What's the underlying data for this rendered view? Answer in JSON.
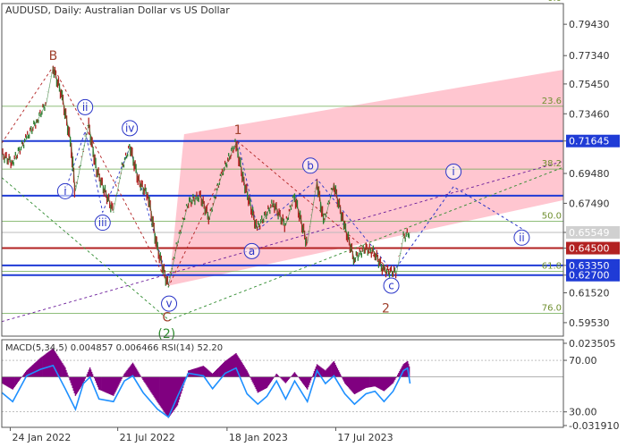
{
  "chart_data": [
    {
      "type": "line",
      "title": "AUDUSD, Daily:  Australian Dollar vs US Dollar",
      "ylim": [
        0.5863,
        0.8081
      ],
      "y_ticks": [
        "0.79430",
        "0.77340",
        "0.75450",
        "0.73460",
        "0.71645",
        "0.69480",
        "0.67490",
        "0.65549",
        "0.64500",
        "0.63350",
        "0.62700",
        "0.61520",
        "0.59530"
      ],
      "x_ticks": [
        "24 Jan 2022",
        "21 Jul 2022",
        "18 Jan 2023",
        "17 Jul 2023"
      ],
      "x_range": [
        "2022-01-10",
        "2023-11-20"
      ],
      "price_path": [
        {
          "x": "2022-01-10",
          "y": 0.7078
        },
        {
          "x": "2022-01-28",
          "y": 0.702
        },
        {
          "x": "2022-02-20",
          "y": 0.718
        },
        {
          "x": "2022-03-10",
          "y": 0.73
        },
        {
          "x": "2022-03-25",
          "y": 0.742
        },
        {
          "x": "2022-04-05",
          "y": 0.7661
        },
        {
          "x": "2022-04-20",
          "y": 0.747
        },
        {
          "x": "2022-05-05",
          "y": 0.715
        },
        {
          "x": "2022-05-12",
          "y": 0.683
        },
        {
          "x": "2022-05-25",
          "y": 0.71
        },
        {
          "x": "2022-06-03",
          "y": 0.728
        },
        {
          "x": "2022-06-16",
          "y": 0.698
        },
        {
          "x": "2022-06-30",
          "y": 0.683
        },
        {
          "x": "2022-07-14",
          "y": 0.67
        },
        {
          "x": "2022-07-28",
          "y": 0.698
        },
        {
          "x": "2022-08-11",
          "y": 0.713
        },
        {
          "x": "2022-08-25",
          "y": 0.69
        },
        {
          "x": "2022-09-10",
          "y": 0.68
        },
        {
          "x": "2022-09-25",
          "y": 0.645
        },
        {
          "x": "2022-10-13",
          "y": 0.62
        },
        {
          "x": "2022-10-26",
          "y": 0.645
        },
        {
          "x": "2022-11-15",
          "y": 0.675
        },
        {
          "x": "2022-12-05",
          "y": 0.68
        },
        {
          "x": "2022-12-20",
          "y": 0.665
        },
        {
          "x": "2023-01-10",
          "y": 0.695
        },
        {
          "x": "2023-02-02",
          "y": 0.715
        },
        {
          "x": "2023-02-15",
          "y": 0.69
        },
        {
          "x": "2023-03-09",
          "y": 0.658
        },
        {
          "x": "2023-04-05",
          "y": 0.675
        },
        {
          "x": "2023-04-25",
          "y": 0.66
        },
        {
          "x": "2023-05-10",
          "y": 0.68
        },
        {
          "x": "2023-05-31",
          "y": 0.648
        },
        {
          "x": "2023-06-16",
          "y": 0.69
        },
        {
          "x": "2023-06-28",
          "y": 0.662
        },
        {
          "x": "2023-07-14",
          "y": 0.688
        },
        {
          "x": "2023-08-01",
          "y": 0.66
        },
        {
          "x": "2023-08-17",
          "y": 0.638
        },
        {
          "x": "2023-09-05",
          "y": 0.645
        },
        {
          "x": "2023-09-20",
          "y": 0.642
        },
        {
          "x": "2023-10-05",
          "y": 0.63
        },
        {
          "x": "2023-10-26",
          "y": 0.629
        },
        {
          "x": "2023-11-06",
          "y": 0.652
        },
        {
          "x": "2023-11-17",
          "y": 0.6555
        }
      ],
      "fib_levels": [
        {
          "label": "0.0",
          "y": 0.8081
        },
        {
          "label": "23.6",
          "y": 0.7396
        },
        {
          "label": "38.2",
          "y": 0.6977
        },
        {
          "label": "50.0",
          "y": 0.663
        },
        {
          "label": "61.8",
          "y": 0.6296
        },
        {
          "label": "76.0",
          "y": 0.6015
        }
      ],
      "support_resistance": [
        {
          "value": "0.71645",
          "y": 0.71645,
          "color": "#1f3bd6"
        },
        {
          "value": "0.68000",
          "y": 0.68,
          "color": "#1f3bd6"
        },
        {
          "value": "0.64500",
          "y": 0.645,
          "color": "#b22222"
        },
        {
          "value": "0.63350",
          "y": 0.6335,
          "color": "#1f3bd6"
        },
        {
          "value": "0.62700",
          "y": 0.627,
          "color": "#1f3bd6"
        }
      ],
      "current_price": {
        "value": "0.65549",
        "y": 0.65549
      },
      "wave_labels": [
        {
          "text": "B",
          "x": "2022-04-05",
          "y": 0.7735,
          "color": "#a0412d",
          "circle": false
        },
        {
          "text": "ii",
          "x": "2022-05-28",
          "y": 0.739,
          "color": "#2a35c8",
          "circle": true
        },
        {
          "text": "iv",
          "x": "2022-08-10",
          "y": 0.725,
          "color": "#2a35c8",
          "circle": true
        },
        {
          "text": "i",
          "x": "2022-04-25",
          "y": 0.683,
          "color": "#2a35c8",
          "circle": true
        },
        {
          "text": "iii",
          "x": "2022-06-26",
          "y": 0.662,
          "color": "#2a35c8",
          "circle": true
        },
        {
          "text": "v",
          "x": "2022-10-14",
          "y": 0.608,
          "color": "#2a35c8",
          "circle": true
        },
        {
          "text": "C",
          "x": "2022-10-10",
          "y": 0.599,
          "color": "#a0412d",
          "circle": false
        },
        {
          "text": "(2)",
          "x": "2022-10-10",
          "y": 0.588,
          "color": "#2e8b2e",
          "circle": false
        },
        {
          "text": "1",
          "x": "2023-02-05",
          "y": 0.724,
          "color": "#a0412d",
          "circle": false
        },
        {
          "text": "b",
          "x": "2023-06-05",
          "y": 0.7,
          "color": "#2a35c8",
          "circle": true
        },
        {
          "text": "a",
          "x": "2023-02-28",
          "y": 0.643,
          "color": "#2a35c8",
          "circle": true
        },
        {
          "text": "c",
          "x": "2023-10-17",
          "y": 0.62,
          "color": "#2a35c8",
          "circle": true
        },
        {
          "text": "2",
          "x": "2023-10-08",
          "y": 0.605,
          "color": "#a0412d",
          "circle": false
        },
        {
          "text": "i",
          "x": "2024-01-28",
          "y": 0.696,
          "color": "#2a35c8",
          "circle": true
        },
        {
          "text": "ii",
          "x": "2024-05-20",
          "y": 0.652,
          "color": "#2a35c8",
          "circle": true
        }
      ],
      "projection": [
        {
          "x": "2023-10-20",
          "y": 0.629
        },
        {
          "x": "2024-01-28",
          "y": 0.686
        },
        {
          "x": "2024-05-20",
          "y": 0.658
        }
      ],
      "channel": {
        "upper": [
          {
            "x": "2022-11-08",
            "y": 0.721
          },
          {
            "x": "2024-07-28",
            "y": 0.764
          }
        ],
        "lower": [
          {
            "x": "2022-10-14",
            "y": 0.62
          },
          {
            "x": "2024-07-28",
            "y": 0.677
          }
        ]
      },
      "trend_lines": [
        {
          "kind": "dashed",
          "color": "#b22222",
          "points": [
            {
              "x": "2022-01-10",
              "y": 0.715
            },
            {
              "x": "2022-04-05",
              "y": 0.7661
            },
            {
              "x": "2022-10-14",
              "y": 0.62
            },
            {
              "x": "2023-02-05",
              "y": 0.716
            },
            {
              "x": "2023-10-20",
              "y": 0.629
            }
          ]
        },
        {
          "kind": "dashed",
          "color": "#2e8b2e",
          "points": [
            {
              "x": "2022-01-10",
              "y": 0.692
            },
            {
              "x": "2022-10-14",
              "y": 0.597
            }
          ]
        },
        {
          "kind": "dashed",
          "color": "#2e8b2e",
          "points": [
            {
              "x": "2022-10-14",
              "y": 0.597
            },
            {
              "x": "2024-07-28",
              "y": 0.699
            }
          ]
        },
        {
          "kind": "dashed",
          "color": "#6a1b9a",
          "points": [
            {
              "x": "2022-01-10",
              "y": 0.596
            },
            {
              "x": "2024-07-28",
              "y": 0.703
            }
          ]
        },
        {
          "kind": "dashed",
          "color": "#2a35c8",
          "points": [
            {
              "x": "2022-04-25",
              "y": 0.683
            },
            {
              "x": "2022-05-28",
              "y": 0.723
            },
            {
              "x": "2022-06-26",
              "y": 0.669
            },
            {
              "x": "2022-08-10",
              "y": 0.712
            },
            {
              "x": "2022-10-14",
              "y": 0.62
            }
          ]
        },
        {
          "kind": "dashed",
          "color": "#2a35c8",
          "points": [
            {
              "x": "2023-02-05",
              "y": 0.716
            },
            {
              "x": "2023-03-10",
              "y": 0.657
            },
            {
              "x": "2023-06-16",
              "y": 0.691
            },
            {
              "x": "2023-10-20",
              "y": 0.629
            }
          ]
        }
      ]
    },
    {
      "type": "area",
      "title": "MACD(5,34,5) 0.004857 0.006466 RSI(14) 52.20",
      "y_ticks": [
        "0.023505",
        "70.00",
        "30.00",
        "-0.031910"
      ],
      "x_ticks": [
        "24 Jan 2022",
        "21 Jul 2022",
        "18 Jan 2023",
        "17 Jul 2023"
      ],
      "macd_ylim": [
        -0.03191,
        0.023505
      ],
      "rsi_ylim": [
        18,
        86
      ],
      "rsi_levels": [
        70,
        30
      ],
      "macd": [
        {
          "x": "2022-01-10",
          "y": -0.004
        },
        {
          "x": "2022-01-28",
          "y": -0.008
        },
        {
          "x": "2022-02-20",
          "y": 0.004
        },
        {
          "x": "2022-03-15",
          "y": 0.012
        },
        {
          "x": "2022-04-05",
          "y": 0.018
        },
        {
          "x": "2022-04-25",
          "y": 0.006
        },
        {
          "x": "2022-05-12",
          "y": -0.012
        },
        {
          "x": "2022-05-25",
          "y": -0.004
        },
        {
          "x": "2022-06-05",
          "y": 0.006
        },
        {
          "x": "2022-06-20",
          "y": -0.008
        },
        {
          "x": "2022-07-14",
          "y": -0.012
        },
        {
          "x": "2022-08-01",
          "y": 0.002
        },
        {
          "x": "2022-08-15",
          "y": 0.009
        },
        {
          "x": "2022-09-01",
          "y": -0.002
        },
        {
          "x": "2022-09-25",
          "y": -0.016
        },
        {
          "x": "2022-10-13",
          "y": -0.026
        },
        {
          "x": "2022-10-28",
          "y": -0.018
        },
        {
          "x": "2022-11-15",
          "y": 0.004
        },
        {
          "x": "2022-12-10",
          "y": 0.007
        },
        {
          "x": "2022-12-25",
          "y": 0.002
        },
        {
          "x": "2023-01-15",
          "y": 0.01
        },
        {
          "x": "2023-02-02",
          "y": 0.015
        },
        {
          "x": "2023-02-20",
          "y": 0.004
        },
        {
          "x": "2023-03-10",
          "y": -0.01
        },
        {
          "x": "2023-03-25",
          "y": -0.007
        },
        {
          "x": "2023-04-10",
          "y": 0.002
        },
        {
          "x": "2023-04-25",
          "y": -0.004
        },
        {
          "x": "2023-05-10",
          "y": 0.003
        },
        {
          "x": "2023-05-31",
          "y": -0.008
        },
        {
          "x": "2023-06-16",
          "y": 0.008
        },
        {
          "x": "2023-06-30",
          "y": 0.004
        },
        {
          "x": "2023-07-14",
          "y": 0.01
        },
        {
          "x": "2023-08-01",
          "y": -0.004
        },
        {
          "x": "2023-08-17",
          "y": -0.011
        },
        {
          "x": "2023-09-05",
          "y": -0.007
        },
        {
          "x": "2023-09-20",
          "y": -0.006
        },
        {
          "x": "2023-10-05",
          "y": -0.009
        },
        {
          "x": "2023-10-20",
          "y": -0.004
        },
        {
          "x": "2023-11-06",
          "y": 0.008
        },
        {
          "x": "2023-11-13",
          "y": 0.01
        },
        {
          "x": "2023-11-17",
          "y": 0.005
        }
      ],
      "rsi": [
        {
          "x": "2022-01-10",
          "y": 45
        },
        {
          "x": "2022-01-28",
          "y": 38
        },
        {
          "x": "2022-02-20",
          "y": 58
        },
        {
          "x": "2022-03-15",
          "y": 63
        },
        {
          "x": "2022-04-05",
          "y": 66
        },
        {
          "x": "2022-04-25",
          "y": 48
        },
        {
          "x": "2022-05-12",
          "y": 32
        },
        {
          "x": "2022-05-25",
          "y": 52
        },
        {
          "x": "2022-06-05",
          "y": 57
        },
        {
          "x": "2022-06-20",
          "y": 40
        },
        {
          "x": "2022-07-14",
          "y": 38
        },
        {
          "x": "2022-08-01",
          "y": 54
        },
        {
          "x": "2022-08-15",
          "y": 58
        },
        {
          "x": "2022-09-01",
          "y": 45
        },
        {
          "x": "2022-09-25",
          "y": 32
        },
        {
          "x": "2022-10-13",
          "y": 26
        },
        {
          "x": "2022-10-28",
          "y": 42
        },
        {
          "x": "2022-11-15",
          "y": 60
        },
        {
          "x": "2022-12-10",
          "y": 58
        },
        {
          "x": "2022-12-25",
          "y": 48
        },
        {
          "x": "2023-01-15",
          "y": 60
        },
        {
          "x": "2023-02-02",
          "y": 64
        },
        {
          "x": "2023-02-20",
          "y": 44
        },
        {
          "x": "2023-03-10",
          "y": 36
        },
        {
          "x": "2023-03-25",
          "y": 42
        },
        {
          "x": "2023-04-10",
          "y": 54
        },
        {
          "x": "2023-04-25",
          "y": 40
        },
        {
          "x": "2023-05-10",
          "y": 54
        },
        {
          "x": "2023-05-31",
          "y": 38
        },
        {
          "x": "2023-06-16",
          "y": 62
        },
        {
          "x": "2023-06-30",
          "y": 52
        },
        {
          "x": "2023-07-14",
          "y": 58
        },
        {
          "x": "2023-08-01",
          "y": 44
        },
        {
          "x": "2023-08-17",
          "y": 36
        },
        {
          "x": "2023-09-05",
          "y": 44
        },
        {
          "x": "2023-09-20",
          "y": 46
        },
        {
          "x": "2023-10-05",
          "y": 38
        },
        {
          "x": "2023-10-20",
          "y": 46
        },
        {
          "x": "2023-11-06",
          "y": 62
        },
        {
          "x": "2023-11-13",
          "y": 64
        },
        {
          "x": "2023-11-17",
          "y": 52
        }
      ]
    }
  ],
  "colors": {
    "price_line": "#2e7d32",
    "price_up": "#2e7d32",
    "price_down": "#b22222",
    "fib_line": "#6aa84f",
    "fib_label": "#6f8f2f",
    "channel_fill": "#ffc0cb",
    "current_price_line": "#bbbbbb",
    "grid_border": "#555555",
    "macd_fill": "#800080",
    "rsi_line": "#1e90ff",
    "text": "#333333"
  }
}
